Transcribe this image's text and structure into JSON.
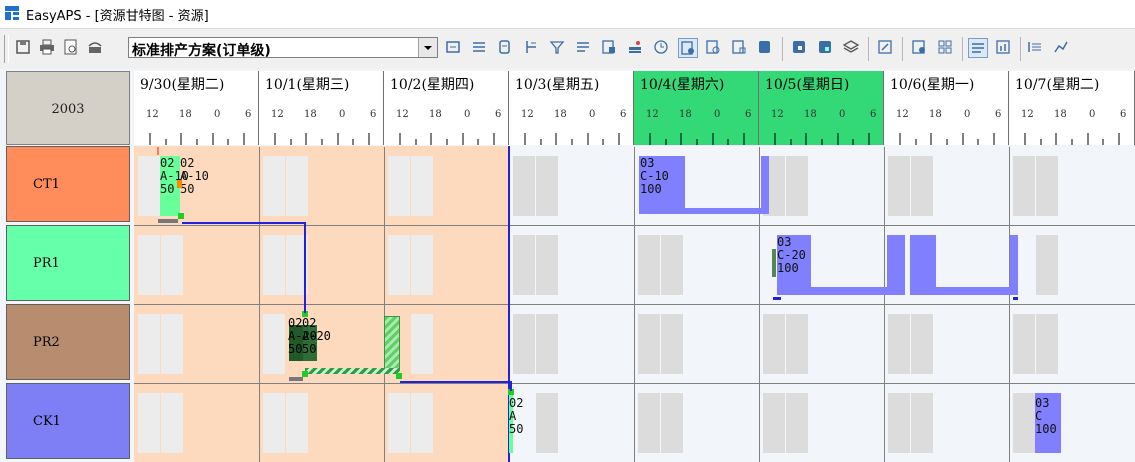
{
  "window": {
    "title": "EasyAPS - [资源甘特图 - 资源]"
  },
  "toolbar": {
    "plan_selector": {
      "value": "标准排产方案(订单级)"
    },
    "buttons": [
      "save-icon",
      "print-icon",
      "preview-icon",
      "print-setup-icon",
      "move-icon",
      "align-icon",
      "copy-icon",
      "split-icon",
      "filter-icon",
      "list-icon",
      "tasks-icon",
      "flag-icon",
      "clock-icon",
      "schedule-a-icon",
      "schedule-b-icon",
      "schedule-c-icon",
      "schedule-d-icon",
      "lock-a-icon",
      "lock-b-icon",
      "layers-icon",
      "edit-icon",
      "view-a-icon",
      "grid-icon",
      "report-a-icon",
      "chart-icon",
      "report-b-icon",
      "report-c-icon"
    ]
  },
  "gantt": {
    "corner_label": "2003",
    "days": [
      {
        "label": "9/30(星期二)",
        "weekend": false
      },
      {
        "label": "10/1(星期三)",
        "weekend": false
      },
      {
        "label": "10/2(星期四)",
        "weekend": false
      },
      {
        "label": "10/3(星期五)",
        "weekend": false
      },
      {
        "label": "10/4(星期六)",
        "weekend": true
      },
      {
        "label": "10/5(星期日)",
        "weekend": true
      },
      {
        "label": "10/6(星期一)",
        "weekend": false
      },
      {
        "label": "10/7(星期二)",
        "weekend": false
      }
    ],
    "hour_ticks": [
      "12",
      "18",
      "0",
      "6"
    ],
    "resources": [
      {
        "name": "CT1",
        "color": "#ff8c5a"
      },
      {
        "name": "PR1",
        "color": "#66ffaa"
      },
      {
        "name": "PR2",
        "color": "#b88c6e"
      },
      {
        "name": "CK1",
        "color": "#7f7ff5"
      }
    ],
    "tasks": [
      {
        "resource": "CT1",
        "text": "02\nA-10\n50",
        "color": "#66ff99"
      },
      {
        "resource": "CT1",
        "text": "02\nA-10\n50",
        "color": "#66ff99"
      },
      {
        "resource": "CT1",
        "text": "03\nC-10\n100",
        "color": "#8080ff"
      },
      {
        "resource": "PR1",
        "text": "03\nC-20\n100",
        "color": "#8080ff"
      },
      {
        "resource": "PR2",
        "text": "02\nA-20\n50",
        "color": "#66cc66"
      },
      {
        "resource": "PR2",
        "text": "02\nA-20\n50",
        "color": "#66cc66"
      },
      {
        "resource": "CK1",
        "text": "02\nA\n50",
        "color": "#66ff99"
      },
      {
        "resource": "CK1",
        "text": "03\nC\n100",
        "color": "#8080ff"
      }
    ]
  }
}
